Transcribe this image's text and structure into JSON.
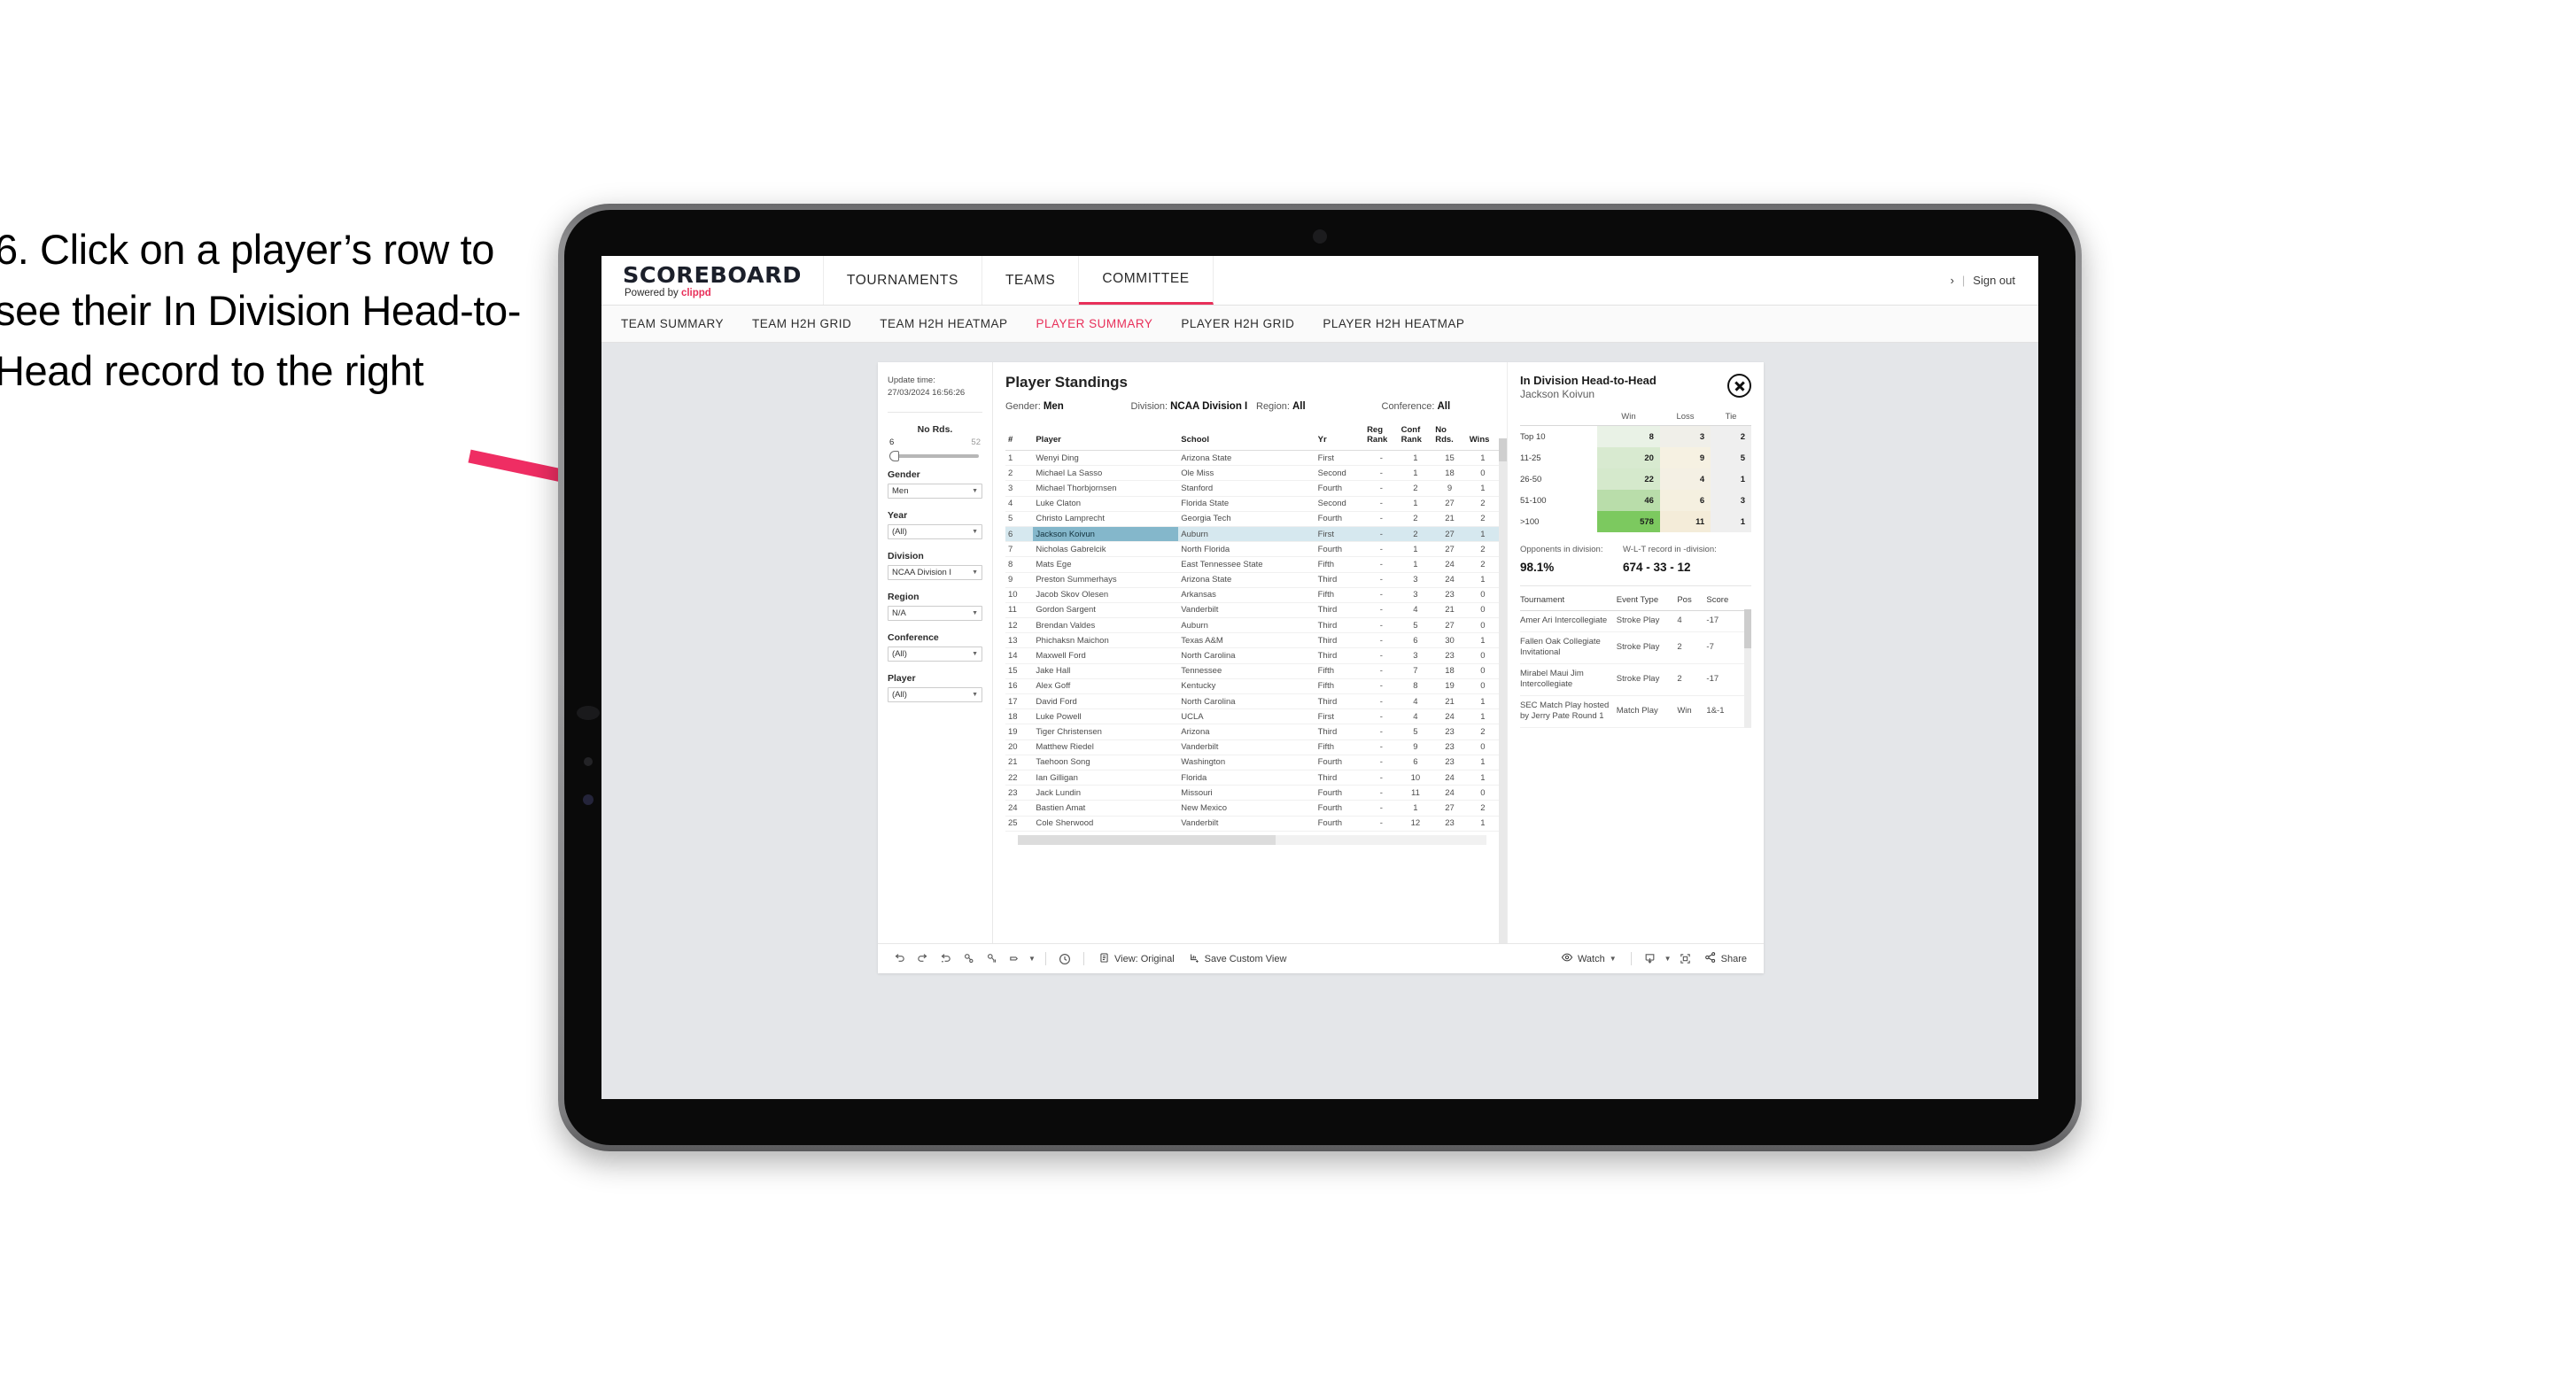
{
  "caption": "6. Click on a player’s row to see their In Division Head-to-Head record to the right",
  "brand": {
    "logo": "SCOREBOARD",
    "powered_prefix": "Powered by ",
    "powered_brand": "clippd",
    "accent": "#e8305a"
  },
  "topnav": [
    {
      "label": "TOURNAMENTS",
      "active": false
    },
    {
      "label": "TEAMS",
      "active": false
    },
    {
      "label": "COMMITTEE",
      "active": true
    }
  ],
  "topbar_right": {
    "chevron": "›",
    "separator": "|",
    "signout": "Sign out"
  },
  "subnav": [
    {
      "label": "TEAM SUMMARY",
      "active": false
    },
    {
      "label": "TEAM H2H GRID",
      "active": false
    },
    {
      "label": "TEAM H2H HEATMAP",
      "active": false
    },
    {
      "label": "PLAYER SUMMARY",
      "active": true
    },
    {
      "label": "PLAYER H2H GRID",
      "active": false
    },
    {
      "label": "PLAYER H2H HEATMAP",
      "active": false
    }
  ],
  "filters": {
    "update_time_label": "Update time:",
    "update_time_value": "27/03/2024 16:56:26",
    "slider": {
      "label": "No Rds.",
      "min": "6",
      "max": "52"
    },
    "groups": [
      {
        "label": "Gender",
        "value": "Men"
      },
      {
        "label": "Year",
        "value": "(All)"
      },
      {
        "label": "Division",
        "value": "NCAA Division I"
      },
      {
        "label": "Region",
        "value": "N/A"
      },
      {
        "label": "Conference",
        "value": "(All)"
      },
      {
        "label": "Player",
        "value": "(All)"
      }
    ]
  },
  "standings": {
    "title": "Player Standings",
    "subhead": [
      {
        "label": "Gender: ",
        "value": "Men"
      },
      {
        "label": "Division: ",
        "value": "NCAA Division I"
      },
      {
        "label": "Region: ",
        "value": "All"
      },
      {
        "label": "Conference: ",
        "value": "All"
      }
    ],
    "columns": [
      "#",
      "Player",
      "School",
      "Yr",
      "Reg Rank",
      "Conf Rank",
      "No Rds.",
      "Wins"
    ],
    "rows": [
      {
        "rank": "1",
        "player": "Wenyi Ding",
        "school": "Arizona State",
        "yr": "First",
        "reg": "-",
        "conf": "1",
        "rds": "15",
        "wins": "1",
        "selected": false
      },
      {
        "rank": "2",
        "player": "Michael La Sasso",
        "school": "Ole Miss",
        "yr": "Second",
        "reg": "-",
        "conf": "1",
        "rds": "18",
        "wins": "0",
        "selected": false
      },
      {
        "rank": "3",
        "player": "Michael Thorbjornsen",
        "school": "Stanford",
        "yr": "Fourth",
        "reg": "-",
        "conf": "2",
        "rds": "9",
        "wins": "1",
        "selected": false
      },
      {
        "rank": "4",
        "player": "Luke Claton",
        "school": "Florida State",
        "yr": "Second",
        "reg": "-",
        "conf": "1",
        "rds": "27",
        "wins": "2",
        "selected": false
      },
      {
        "rank": "5",
        "player": "Christo Lamprecht",
        "school": "Georgia Tech",
        "yr": "Fourth",
        "reg": "-",
        "conf": "2",
        "rds": "21",
        "wins": "2",
        "selected": false
      },
      {
        "rank": "6",
        "player": "Jackson Koivun",
        "school": "Auburn",
        "yr": "First",
        "reg": "-",
        "conf": "2",
        "rds": "27",
        "wins": "1",
        "selected": true
      },
      {
        "rank": "7",
        "player": "Nicholas Gabrelcik",
        "school": "North Florida",
        "yr": "Fourth",
        "reg": "-",
        "conf": "1",
        "rds": "27",
        "wins": "2",
        "selected": false
      },
      {
        "rank": "8",
        "player": "Mats Ege",
        "school": "East Tennessee State",
        "yr": "Fifth",
        "reg": "-",
        "conf": "1",
        "rds": "24",
        "wins": "2",
        "selected": false
      },
      {
        "rank": "9",
        "player": "Preston Summerhays",
        "school": "Arizona State",
        "yr": "Third",
        "reg": "-",
        "conf": "3",
        "rds": "24",
        "wins": "1",
        "selected": false
      },
      {
        "rank": "10",
        "player": "Jacob Skov Olesen",
        "school": "Arkansas",
        "yr": "Fifth",
        "reg": "-",
        "conf": "3",
        "rds": "23",
        "wins": "0",
        "selected": false
      },
      {
        "rank": "11",
        "player": "Gordon Sargent",
        "school": "Vanderbilt",
        "yr": "Third",
        "reg": "-",
        "conf": "4",
        "rds": "21",
        "wins": "0",
        "selected": false
      },
      {
        "rank": "12",
        "player": "Brendan Valdes",
        "school": "Auburn",
        "yr": "Third",
        "reg": "-",
        "conf": "5",
        "rds": "27",
        "wins": "0",
        "selected": false
      },
      {
        "rank": "13",
        "player": "Phichaksn Maichon",
        "school": "Texas A&M",
        "yr": "Third",
        "reg": "-",
        "conf": "6",
        "rds": "30",
        "wins": "1",
        "selected": false
      },
      {
        "rank": "14",
        "player": "Maxwell Ford",
        "school": "North Carolina",
        "yr": "Third",
        "reg": "-",
        "conf": "3",
        "rds": "23",
        "wins": "0",
        "selected": false
      },
      {
        "rank": "15",
        "player": "Jake Hall",
        "school": "Tennessee",
        "yr": "Fifth",
        "reg": "-",
        "conf": "7",
        "rds": "18",
        "wins": "0",
        "selected": false
      },
      {
        "rank": "16",
        "player": "Alex Goff",
        "school": "Kentucky",
        "yr": "Fifth",
        "reg": "-",
        "conf": "8",
        "rds": "19",
        "wins": "0",
        "selected": false
      },
      {
        "rank": "17",
        "player": "David Ford",
        "school": "North Carolina",
        "yr": "Third",
        "reg": "-",
        "conf": "4",
        "rds": "21",
        "wins": "1",
        "selected": false
      },
      {
        "rank": "18",
        "player": "Luke Powell",
        "school": "UCLA",
        "yr": "First",
        "reg": "-",
        "conf": "4",
        "rds": "24",
        "wins": "1",
        "selected": false
      },
      {
        "rank": "19",
        "player": "Tiger Christensen",
        "school": "Arizona",
        "yr": "Third",
        "reg": "-",
        "conf": "5",
        "rds": "23",
        "wins": "2",
        "selected": false
      },
      {
        "rank": "20",
        "player": "Matthew Riedel",
        "school": "Vanderbilt",
        "yr": "Fifth",
        "reg": "-",
        "conf": "9",
        "rds": "23",
        "wins": "0",
        "selected": false
      },
      {
        "rank": "21",
        "player": "Taehoon Song",
        "school": "Washington",
        "yr": "Fourth",
        "reg": "-",
        "conf": "6",
        "rds": "23",
        "wins": "1",
        "selected": false
      },
      {
        "rank": "22",
        "player": "Ian Gilligan",
        "school": "Florida",
        "yr": "Third",
        "reg": "-",
        "conf": "10",
        "rds": "24",
        "wins": "1",
        "selected": false
      },
      {
        "rank": "23",
        "player": "Jack Lundin",
        "school": "Missouri",
        "yr": "Fourth",
        "reg": "-",
        "conf": "11",
        "rds": "24",
        "wins": "0",
        "selected": false
      },
      {
        "rank": "24",
        "player": "Bastien Amat",
        "school": "New Mexico",
        "yr": "Fourth",
        "reg": "-",
        "conf": "1",
        "rds": "27",
        "wins": "2",
        "selected": false
      },
      {
        "rank": "25",
        "player": "Cole Sherwood",
        "school": "Vanderbilt",
        "yr": "Fourth",
        "reg": "-",
        "conf": "12",
        "rds": "23",
        "wins": "1",
        "selected": false
      }
    ]
  },
  "detail": {
    "title": "In Division Head-to-Head",
    "player": "Jackson Koivun",
    "close_icon": "close-circle-icon",
    "h2h": {
      "columns": [
        "",
        "Win",
        "Loss",
        "Tie"
      ],
      "rows": [
        {
          "bucket": "Top 10",
          "win": "8",
          "loss": "3",
          "tie": "2",
          "win_color": "#e9f2e6",
          "loss_color": "#f0efe9",
          "tie_color": "#efefef"
        },
        {
          "bucket": "11-25",
          "win": "20",
          "loss": "9",
          "tie": "5",
          "win_color": "#d8ead0",
          "loss_color": "#f6f1e2",
          "tie_color": "#efefef"
        },
        {
          "bucket": "26-50",
          "win": "22",
          "loss": "4",
          "tie": "1",
          "win_color": "#d5e9cc",
          "loss_color": "#f4f0e4",
          "tie_color": "#efefef"
        },
        {
          "bucket": "51-100",
          "win": "46",
          "loss": "6",
          "tie": "3",
          "win_color": "#b9ddaa",
          "loss_color": "#f5f0e0",
          "tie_color": "#efefef"
        },
        {
          "bucket": ">100",
          "win": "578",
          "loss": "11",
          "tie": "1",
          "win_color": "#7cc95f",
          "loss_color": "#f4ecd9",
          "tie_color": "#efefef"
        }
      ]
    },
    "stats": [
      {
        "label": "Opponents in division:",
        "value": "98.1%"
      },
      {
        "label": "W-L-T record in -division:",
        "value": "674 - 33 - 12"
      }
    ],
    "tournaments": {
      "columns": [
        "Tournament",
        "Event Type",
        "Pos",
        "Score"
      ],
      "rows": [
        {
          "name": "Amer Ari Intercollegiate",
          "type": "Stroke Play",
          "pos": "4",
          "score": "-17"
        },
        {
          "name": "Fallen Oak Collegiate Invitational",
          "type": "Stroke Play",
          "pos": "2",
          "score": "-7"
        },
        {
          "name": "Mirabel Maui Jim Intercollegiate",
          "type": "Stroke Play",
          "pos": "2",
          "score": "-17"
        },
        {
          "name": "SEC Match Play hosted by Jerry Pate Round 1",
          "type": "Match Play",
          "pos": "Win",
          "score": "1&-1"
        }
      ]
    }
  },
  "toolbar": {
    "icons": [
      "undo-icon",
      "redo-icon",
      "revert-icon",
      "refresh-data-icon",
      "pause-updates-icon",
      "highlight-icon"
    ],
    "alerts_icon": "alerts-clock-icon",
    "view_label": "View: Original",
    "view_icon": "view-original-icon",
    "save_view_label": "Save Custom View",
    "save_view_icon": "save-custom-view-icon",
    "watch_label": "Watch",
    "watch_icon": "eye-icon",
    "download_icon": "download-icon",
    "fullscreen_icon": "fullscreen-icon",
    "share_label": "Share",
    "share_icon": "share-icon"
  },
  "annotation": {
    "arrow_color": "#ef2d63"
  }
}
